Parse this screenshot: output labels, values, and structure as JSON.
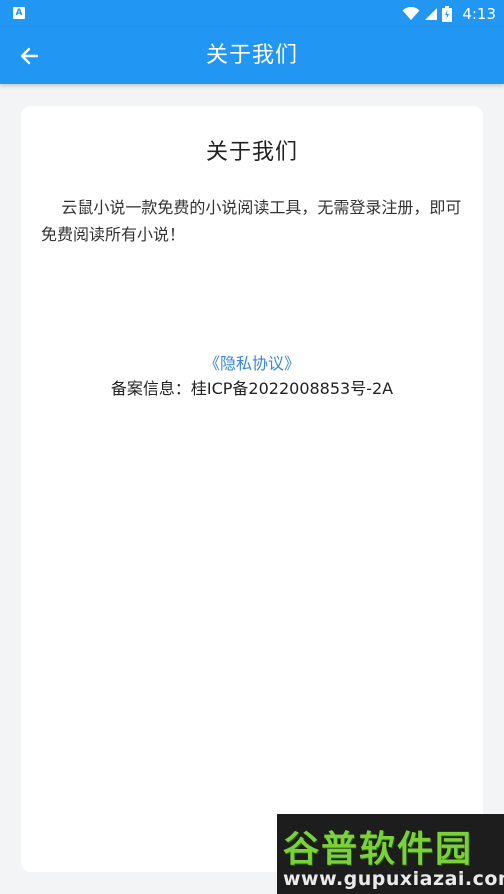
{
  "status_bar": {
    "badge": "A",
    "time": "4:13"
  },
  "app_bar": {
    "title": "关于我们"
  },
  "card": {
    "title": "关于我们",
    "body": "云鼠小说一款免费的小说阅读工具，无需登录注册，即可免费阅读所有小说！",
    "privacy_link": "《隐私协议》",
    "beian": "备案信息：桂ICP备2022008853号-2A"
  },
  "watermark": {
    "main": "谷普软件园",
    "url": "www.gupuxiazai.com"
  },
  "colors": {
    "primary": "#2196f3",
    "link": "#3a86d8"
  }
}
